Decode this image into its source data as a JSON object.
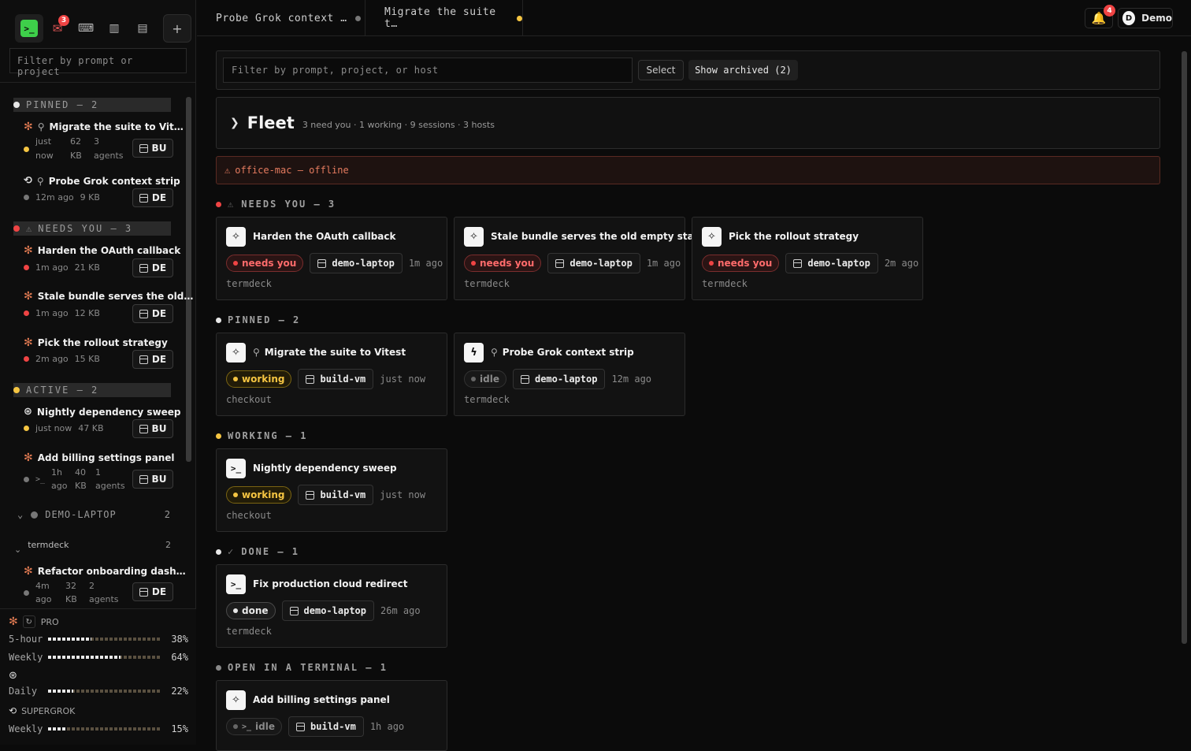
{
  "sidebar": {
    "tabs": [
      {
        "icon": "terminal-icon",
        "glyph": ">_"
      },
      {
        "icon": "inbox-icon",
        "glyph": "✉",
        "badge": "3"
      },
      {
        "icon": "console-icon",
        "glyph": "⌨"
      },
      {
        "icon": "chart-icon",
        "glyph": "▥"
      },
      {
        "icon": "archive-icon",
        "glyph": "▤"
      },
      {
        "icon": "plus-icon",
        "glyph": "+"
      }
    ],
    "filter_placeholder": "Filter by prompt or project",
    "pinned": {
      "label": "PINNED — 2",
      "items": [
        {
          "title": "Migrate the suite to Vit…",
          "meta1": "just now",
          "meta2": "62 KB",
          "meta3": "3 agents",
          "host": "BU",
          "status": "#f5c542"
        },
        {
          "title": "Probe Grok context strip",
          "meta1": "12m ago",
          "meta2": "9 KB",
          "meta3": "",
          "host": "DE",
          "status": "#777777"
        }
      ]
    },
    "needs": {
      "label": "NEEDS YOU — 3",
      "items": [
        {
          "title": "Harden the OAuth callback",
          "meta1": "1m ago",
          "meta2": "21 KB",
          "host": "DE"
        },
        {
          "title": "Stale bundle serves the old…",
          "meta1": "1m ago",
          "meta2": "12 KB",
          "host": "DE"
        },
        {
          "title": "Pick the rollout strategy",
          "meta1": "2m ago",
          "meta2": "15 KB",
          "host": "DE"
        }
      ]
    },
    "active": {
      "label": "ACTIVE — 2",
      "items": [
        {
          "title": "Nightly dependency sweep",
          "meta1": "just now",
          "meta2": "47 KB",
          "host": "BU"
        },
        {
          "title": "Add billing settings panel",
          "meta1": "1h ago",
          "meta2": "40 KB",
          "meta3": "1 agents",
          "host": "BU"
        }
      ]
    },
    "host_group": {
      "label": "DEMO-LAPTOP",
      "count": "2"
    },
    "project_group": {
      "label": "termdeck",
      "count": "2"
    },
    "extra_item": {
      "title": "Refactor onboarding dash…",
      "meta1": "4m ago",
      "meta2": "32 KB",
      "meta3": "2 agents",
      "host": "DE"
    },
    "usage": {
      "pro_label": "PRO",
      "rows": [
        {
          "label": "5-hour",
          "pct": "38%",
          "fill": 0.38
        },
        {
          "label": "Weekly",
          "pct": "64%",
          "fill": 0.64
        },
        {
          "label": "Daily",
          "pct": "22%",
          "fill": 0.22
        },
        {
          "label": "Weekly",
          "pct": "15%",
          "fill": 0.15
        }
      ],
      "grok_label": "SUPERGROK"
    }
  },
  "topbar": {
    "tabs": [
      {
        "label": "Probe Grok context …",
        "dot": "#777777"
      },
      {
        "label": "Migrate the suite t…",
        "dot": "#f5c542"
      }
    ],
    "bell_badge": "4",
    "user_initial": "D",
    "user_name": "Demo"
  },
  "main": {
    "filter_placeholder": "Filter by prompt, project, or host",
    "select_label": "Select",
    "archived_label": "Show archived (2)",
    "fleet": {
      "title": "Fleet",
      "summary": "3 need you · 1 working · 9 sessions · 3 hosts"
    },
    "offline": "office-mac — offline",
    "groups": {
      "needs": "NEEDS YOU — 3",
      "pinned": "PINNED — 2",
      "working": "WORKING — 1",
      "done": "DONE — 1",
      "open": "OPEN IN A TERMINAL — 1"
    },
    "cards": {
      "oauth": {
        "title": "Harden the OAuth callback",
        "status": "needs you",
        "host": "demo-laptop",
        "ago": "1m ago",
        "project": "termdeck"
      },
      "stale": {
        "title": "Stale bundle serves the old empty state",
        "status": "needs you",
        "host": "demo-laptop",
        "ago": "1m ago",
        "project": "termdeck"
      },
      "rollout": {
        "title": "Pick the rollout strategy",
        "status": "needs you",
        "host": "demo-laptop",
        "ago": "2m ago",
        "project": "termdeck"
      },
      "vitest": {
        "title": "Migrate the suite to Vitest",
        "status": "working",
        "host": "build-vm",
        "ago": "just now",
        "project": "checkout"
      },
      "grok": {
        "title": "Probe Grok context strip",
        "status": "idle",
        "host": "demo-laptop",
        "ago": "12m ago",
        "project": "termdeck"
      },
      "nightly": {
        "title": "Nightly dependency sweep",
        "status": "working",
        "host": "build-vm",
        "ago": "just now",
        "project": "checkout"
      },
      "fix": {
        "title": "Fix production cloud redirect",
        "status": "done",
        "host": "demo-laptop",
        "ago": "26m ago",
        "project": "termdeck"
      },
      "billing": {
        "title": "Add billing settings panel",
        "status": "idle",
        "host": "build-vm",
        "ago": "1h ago",
        "project": "checkout"
      }
    }
  },
  "colors": {
    "accent_green": "#3ecf4a",
    "needs_red": "#ef4444",
    "working_yellow": "#f5c542",
    "claude_orange": "#e07a52"
  }
}
